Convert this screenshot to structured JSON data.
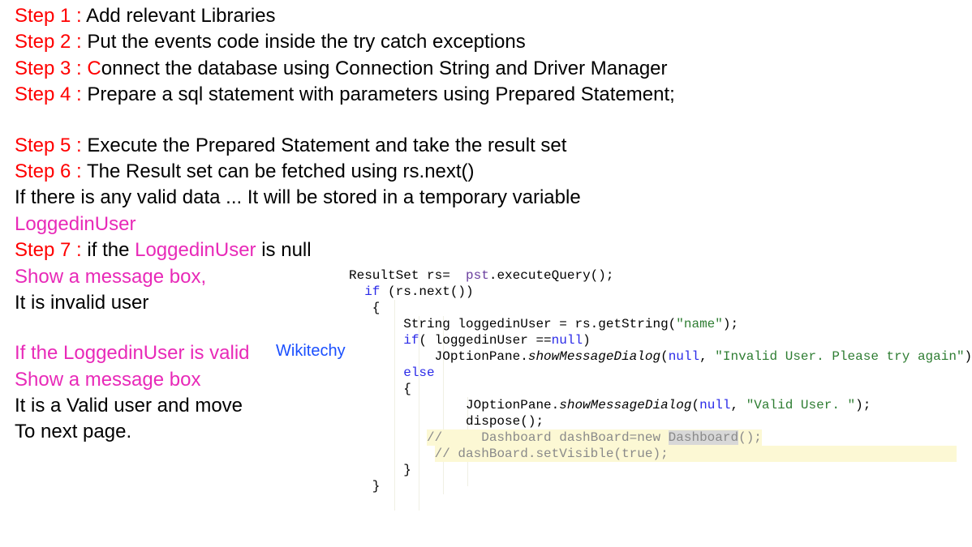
{
  "steps": {
    "s1_label": "Step 1 :",
    "s1_text": " Add relevant Libraries",
    "s2_label": "Step 2 :",
    "s2_text": " Put the events code inside the try catch exceptions",
    "s3_label": "Step 3 :",
    "s3_c": " C",
    "s3_text": "onnect the database using Connection String and Driver Manager",
    "s4_label": "Step 4 :",
    "s4_text": " Prepare a sql statement with parameters using Prepared Statement;",
    "s5_label": "Step 5 :",
    "s5_text": " Execute the Prepared Statement and take the result set",
    "s6_label": "Step 6 :",
    "s6_text": " The Result set can be fetched using rs.next()",
    "if_line": "If there is any valid data ... It will be stored in a temporary variable",
    "loggedin_pink": "LoggedinUser",
    "s7_label": "Step 7 :",
    "s7_pre": " if the ",
    "s7_pink": "LoggedinUser",
    "s7_post": " is null",
    "show_msg": "Show a message box,",
    "invalid": "It is invalid user",
    "if_valid": "If the LoggedinUser is valid",
    "show_msg2": "Show a message box",
    "valid_move": "It is a Valid user and move",
    "to_next": "To next page."
  },
  "watermark": "Wikitechy",
  "code": {
    "l1_a": "ResultSet rs=  ",
    "l1_b": "pst",
    "l1_c": ".executeQuery();",
    "l2_a": "  ",
    "l2_if": "if",
    "l2_b": " (rs.next())",
    "l3": "   {",
    "l4_a": "       String loggedinUser = rs.getString(",
    "l4_str": "\"name\"",
    "l4_b": ");",
    "l5_a": "       ",
    "l5_if": "if",
    "l5_b": "( loggedinUser ==",
    "l5_null": "null",
    "l5_c": ")",
    "l6_a": "           JOptionPane.",
    "l6_m": "showMessageDialog",
    "l6_b": "(",
    "l6_null": "null",
    "l6_c": ", ",
    "l6_str": "\"Invalid User. Please try again\"",
    "l6_d": ");",
    "l7_a": "       ",
    "l7_else": "else",
    "l8": "       {",
    "l9_a": "               JOptionPane.",
    "l9_m": "showMessageDialog",
    "l9_b": "(",
    "l9_null": "null",
    "l9_c": ", ",
    "l9_str": "\"Valid User. \"",
    "l9_d": ");",
    "l10": "               dispose();",
    "l11_a": "          ",
    "l11_cmt_a": "//     Dashboard dashBoard=new ",
    "l11_hl": "Dashboard",
    "l11_cmt_b": "();",
    "l12_a": "           ",
    "l12_cmt": "// dashBoard.setVisible(true);                                     ",
    "l13": "       }",
    "l14": "   }"
  }
}
